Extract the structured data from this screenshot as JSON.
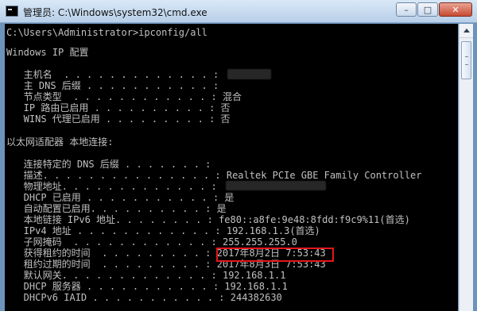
{
  "window": {
    "title": "管理员: C:\\Windows\\system32\\cmd.exe",
    "buttons": {
      "minimize": "–",
      "maximize": "□",
      "close": "✕"
    }
  },
  "console": {
    "lines": [
      "C:\\Users\\Administrator>ipconfig/all",
      "",
      "Windows IP 配置",
      "",
      "   主机名  . . . . . . . . . . . . . :",
      "   主 DNS 后缀 . . . . . . . . . . . :",
      "   节点类型  . . . . . . . . . . . . : 混合",
      "   IP 路由已启用 . . . . . . . . . . : 否",
      "   WINS 代理已启用 . . . . . . . . . : 否",
      "",
      "以太网适配器 本地连接:",
      "",
      "   连接特定的 DNS 后缀 . . . . . . . :",
      "   描述. . . . . . . . . . . . . . . : Realtek PCIe GBE Family Controller",
      "   物理地址. . . . . . . . . . . . . :",
      "   DHCP 已启用 . . . . . . . . . . . : 是",
      "   自动配置已启用. . . . . . . . . . : 是",
      "   本地链接 IPv6 地址. . . . . . . . : fe80::a8fe:9e48:8fdd:f9c9%11(首选)",
      "   IPv4 地址 . . . . . . . . . . . . : 192.168.1.3(首选)",
      "   子网掩码  . . . . . . . . . . . . : 255.255.255.0",
      "   获得租约的时间  . . . . . . . . . : 2017年8月2日 7:53:43",
      "   租约过期的时间  . . . . . . . . . : 2017年8月3日 7:53:43",
      "   默认网关. . . . . . . . . . . . . : 192.168.1.1",
      "   DHCP 服务器 . . . . . . . . . . . : 192.168.1.1",
      "   DHCPv6 IAID . . . . . . . . . . . : 244382630"
    ]
  }
}
